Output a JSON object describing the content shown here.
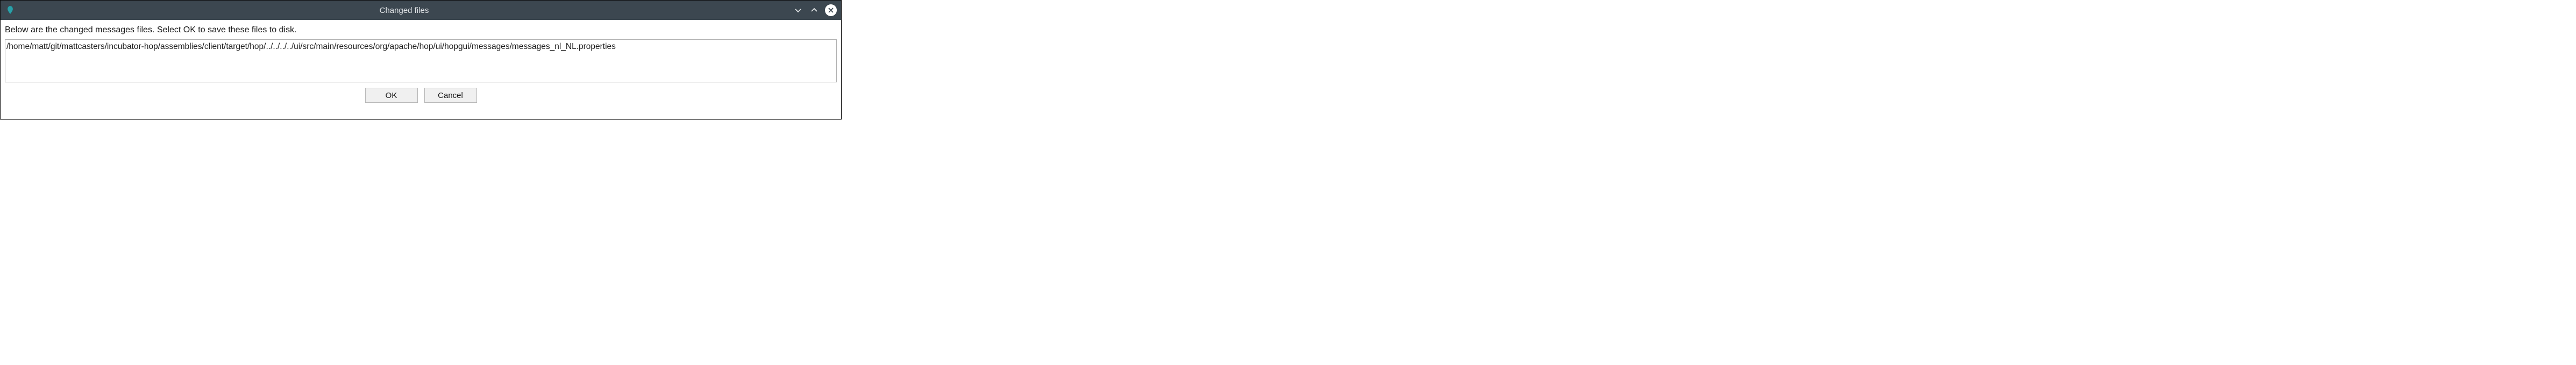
{
  "window": {
    "title": "Changed files"
  },
  "content": {
    "description": "Below are the changed messages files.  Select OK to save these files to disk.",
    "files": [
      "/home/matt/git/mattcasters/incubator-hop/assemblies/client/target/hop/../../../../ui/src/main/resources/org/apache/hop/ui/hopgui/messages/messages_nl_NL.properties"
    ]
  },
  "buttons": {
    "ok_label": "OK",
    "cancel_label": "Cancel"
  }
}
